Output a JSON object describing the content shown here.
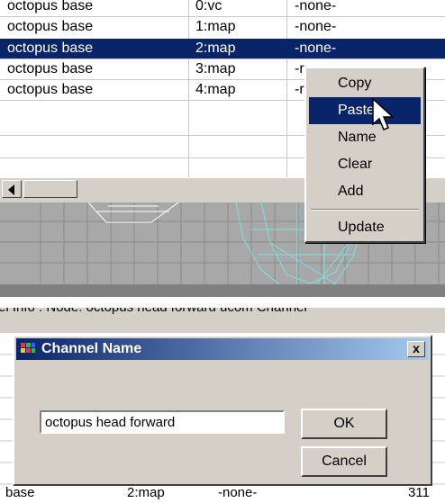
{
  "top_table": {
    "rows": [
      {
        "name": "octopus base",
        "channel": "0:vc",
        "value": "-none-"
      },
      {
        "name": "octopus base",
        "channel": "1:map",
        "value": "-none-"
      },
      {
        "name": "octopus base",
        "channel": "2:map",
        "value": "-none-"
      },
      {
        "name": "octopus base",
        "channel": "3:map",
        "value": "-r"
      },
      {
        "name": "octopus base",
        "channel": "4:map",
        "value": "-r"
      }
    ]
  },
  "context_menu": {
    "items": [
      "Copy",
      "Paste",
      "Name",
      "Clear",
      "Add"
    ],
    "update_label": "Update",
    "active_item": "Paste"
  },
  "info_line": "el Info : Node: octopus head forward ucom Channel",
  "dialog": {
    "title": "Channel Name",
    "close_glyph": "x",
    "input_value": "octopus head forward",
    "ok_label": "OK",
    "cancel_label": "Cancel"
  },
  "background_table": {
    "last_row": {
      "name": "base",
      "channel": "2:map",
      "value": "-none-",
      "count": "311"
    }
  },
  "colors": {
    "selection": "#0a246a",
    "face": "#d4d0c8",
    "title_gradient_end": "#a6caf0",
    "wireframe": "#7fe0e0"
  },
  "icons": {
    "dialog_icon": "app-grid-icon",
    "cursor": "arrow-cursor-icon",
    "scroll_left": "triangle-left-icon"
  }
}
